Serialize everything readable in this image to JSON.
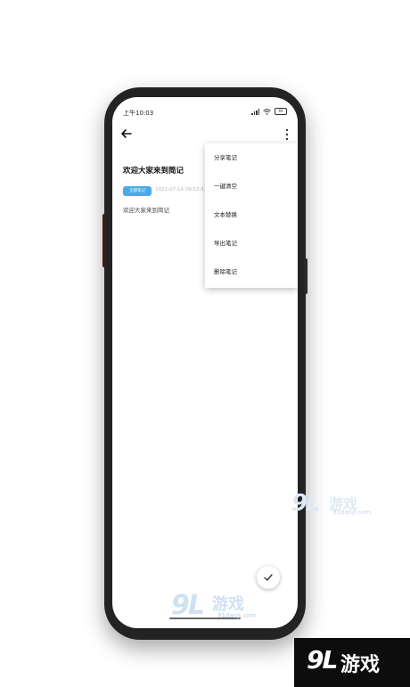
{
  "status_bar": {
    "time": "上午10:03",
    "battery": "69"
  },
  "note": {
    "title": "欢迎大家来到简记",
    "tag": "全部笔记",
    "date": "2021-07-14 09:52:5",
    "body": "欢迎大家来到简记"
  },
  "menu": {
    "items": [
      "分享笔记",
      "一键清空",
      "文本替换",
      "导出笔记",
      "删除笔记"
    ]
  },
  "icons": {
    "back": "arrow-left-icon",
    "more": "more-vertical-icon",
    "save": "check-icon"
  },
  "watermark": {
    "logo": "9L",
    "name": "游戏",
    "domain": "91danji.com"
  },
  "colors": {
    "tag_bg": "#4aa9e8",
    "accent": "#4aa9e8"
  }
}
